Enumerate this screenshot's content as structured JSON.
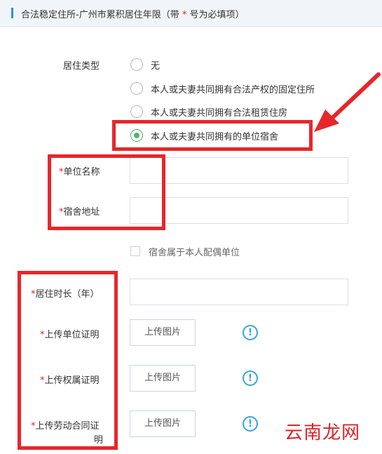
{
  "header": {
    "title_prefix": "合法稳定住所-广州市累积居住年限（带 ",
    "required_mark": "*",
    "title_suffix": " 号为必填项）"
  },
  "residence_type": {
    "label": "居住类型",
    "options": [
      {
        "label": "无",
        "checked": false
      },
      {
        "label": "本人或夫妻共同拥有合法产权的固定住所",
        "checked": false
      },
      {
        "label": "本人或夫妻共同拥有合法租赁住房",
        "checked": false
      },
      {
        "label": "本人或夫妻共同拥有的单位宿舍",
        "checked": true
      }
    ]
  },
  "fields": {
    "required_mark": "*",
    "unit_name_label": "单位名称",
    "dorm_address_label": "宿舍地址",
    "unit_name_value": "",
    "dorm_address_value": ""
  },
  "spouse_checkbox": {
    "label": "宿舍属于本人配偶单位",
    "checked": false
  },
  "duration": {
    "label": "居住时长（年）",
    "value": ""
  },
  "uploads": [
    {
      "label": "上传单位证明",
      "button": "上传图片",
      "icon": "!"
    },
    {
      "label": "上传权属证明",
      "button": "上传图片",
      "icon": "!"
    },
    {
      "label_line1": "上传劳动合同证",
      "label_line2": "明",
      "button": "上传图片",
      "icon": "!"
    }
  ],
  "annotations": {
    "highlight_color": "#e8262a",
    "icon_color": "#35a6e0",
    "accent_color": "#52b46b"
  },
  "watermark": {
    "text": "云南龙网"
  }
}
